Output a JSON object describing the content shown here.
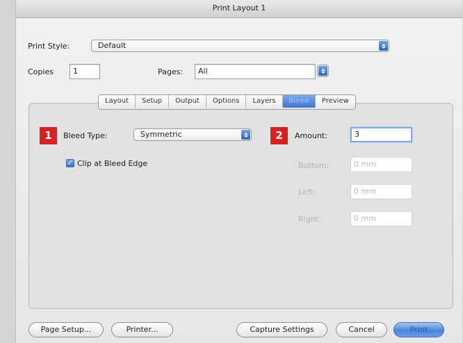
{
  "window": {
    "title": "Print Layout 1"
  },
  "print_style": {
    "label": "Print Style:",
    "value": "Default"
  },
  "copies": {
    "label": "Copies",
    "value": "1"
  },
  "pages": {
    "label": "Pages:",
    "value": "All"
  },
  "tabs": [
    {
      "label": "Layout",
      "active": false
    },
    {
      "label": "Setup",
      "active": false
    },
    {
      "label": "Output",
      "active": false
    },
    {
      "label": "Options",
      "active": false
    },
    {
      "label": "Layers",
      "active": false
    },
    {
      "label": "Bleed",
      "active": true
    },
    {
      "label": "Preview",
      "active": false
    }
  ],
  "bleed": {
    "type_label": "Bleed Type:",
    "type_value": "Symmetric",
    "clip_label": "Clip at Bleed Edge",
    "clip_checked": true,
    "amount_label": "Amount:",
    "amount_value": "3",
    "bottom_label": "Bottom:",
    "bottom_value": "0 mm",
    "left_label": "Left:",
    "left_value": "0 mm",
    "right_label": "Right:",
    "right_value": "0 mm"
  },
  "callouts": {
    "one": "1",
    "two": "2",
    "color": "#d7201f"
  },
  "buttons": {
    "page_setup": "Page Setup...",
    "printer": "Printer...",
    "capture": "Capture Settings",
    "cancel": "Cancel",
    "print": "Print"
  },
  "colors": {
    "accent": "#3f73cc",
    "background": "#e7e7e7"
  }
}
